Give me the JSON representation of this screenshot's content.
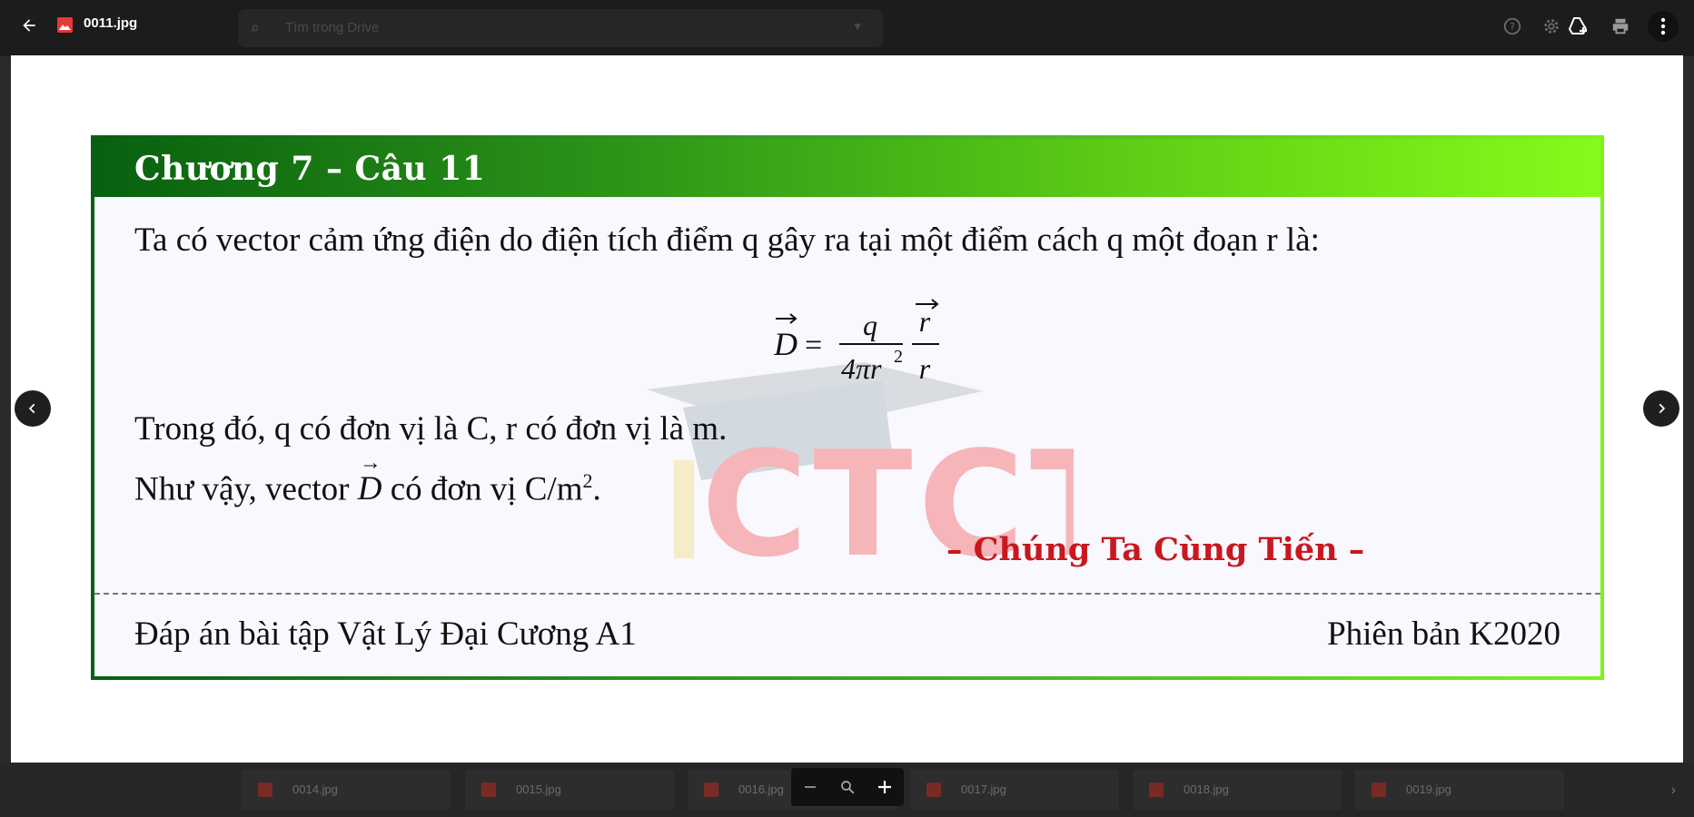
{
  "viewer": {
    "file_name": "0011.jpg",
    "search_placeholder": "Tìm trong Drive"
  },
  "thumbnails": [
    "0014.jpg",
    "0015.jpg",
    "0016.jpg",
    "0017.jpg",
    "0018.jpg",
    "0019.jpg"
  ],
  "slide": {
    "title": "Chương 7 – Câu 11",
    "line1": "Ta có vector cảm ứng điện do điện tích điểm q gây ra tại một điểm cách q một đoạn r là:",
    "formula": {
      "lhs": "D",
      "numerator": "q",
      "denominator": "4πr",
      "exponent": "2",
      "r_top": "r",
      "r_bottom": "r"
    },
    "line2": "Trong đó, q có đơn vị là C, r có đơn vị là m.",
    "line3_prefix": "Như vậy, vector",
    "line3_vec": "D",
    "line3_suffix": "có đơn vị C/m",
    "line3_exp": "2",
    "line3_end": ".",
    "slogan": "– Chúng Ta Cùng Tiến –",
    "footer_left": "Đáp án bài tập Vật Lý Đại Cương A1",
    "footer_right": "Phiên bản K2020",
    "watermark_text": "CTCT"
  },
  "colors": {
    "accent_dark": "#08600f",
    "accent_light": "#86fb1a",
    "slogan": "#c8181e"
  }
}
